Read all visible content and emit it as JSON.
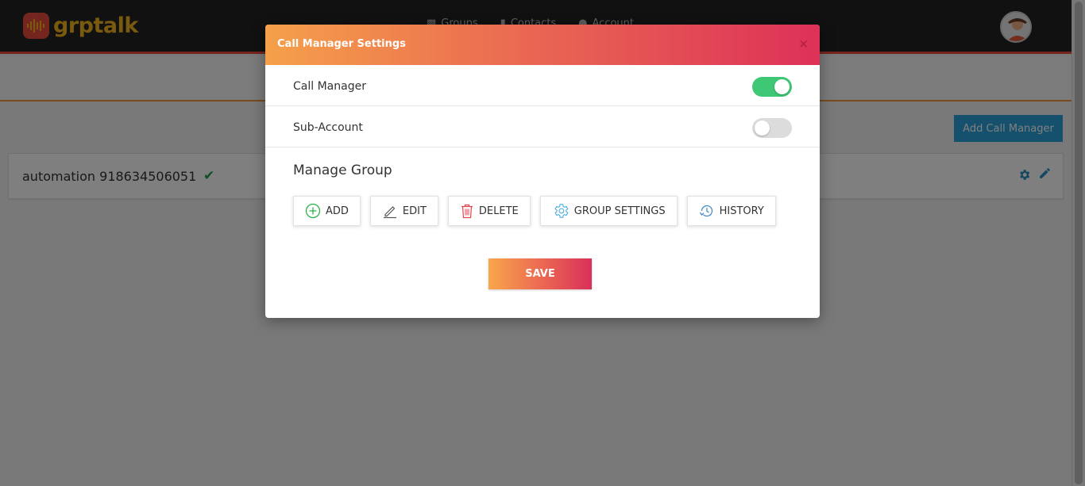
{
  "app": {
    "logo_text": "grptalk"
  },
  "nav": {
    "items": [
      {
        "label": "Groups",
        "icon": "groups-icon"
      },
      {
        "label": "Contacts",
        "icon": "contacts-icon"
      },
      {
        "label": "Account",
        "icon": "account-icon"
      }
    ]
  },
  "page": {
    "add_call_manager_label": "Add Call Manager",
    "call_manager": {
      "name": "automation 918634506051",
      "verified": true
    }
  },
  "modal": {
    "title": "Call Manager Settings",
    "close_label": "×",
    "settings": [
      {
        "label": "Call Manager",
        "enabled": true
      },
      {
        "label": "Sub-Account",
        "enabled": false
      }
    ],
    "section_title": "Manage Group",
    "actions": [
      {
        "label": "ADD",
        "icon": "add-circle-icon",
        "color": "#2db34a"
      },
      {
        "label": "EDIT",
        "icon": "pencil-icon",
        "color": "#555555"
      },
      {
        "label": "DELETE",
        "icon": "trash-icon",
        "color": "#e0454f"
      },
      {
        "label": "GROUP SETTINGS",
        "icon": "gear-icon",
        "color": "#3aa6dd"
      },
      {
        "label": "HISTORY",
        "icon": "history-icon",
        "color": "#3d85c6"
      }
    ],
    "save_label": "SAVE"
  },
  "colors": {
    "toggle_on": "#3ec774",
    "toggle_off": "#dcdcdc",
    "header_gradient_start": "#f5a04a",
    "header_gradient_end": "#dd3158",
    "accent_blue": "#2aa3d8"
  }
}
